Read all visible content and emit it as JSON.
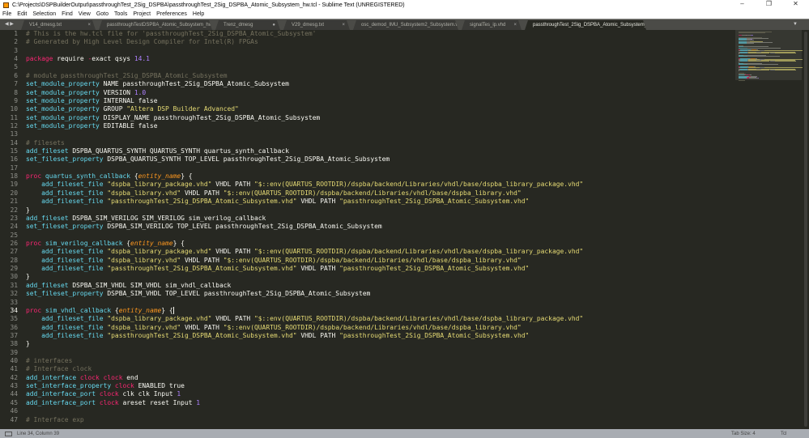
{
  "window": {
    "title": "C:\\Projects\\DSPBuilderOutput\\passthroughTest_2Sig_DSPBA\\passthroughTest_2Sig_DSPBA_Atomic_Subsystem_hw.tcl - Sublime Text (UNREGISTERED)",
    "minimize": "–",
    "maximize": "❐",
    "close": "✕"
  },
  "menu": [
    "File",
    "Edit",
    "Selection",
    "Find",
    "View",
    "Goto",
    "Tools",
    "Project",
    "Preferences",
    "Help"
  ],
  "tabs": [
    {
      "label": "V14_dmesg.txt",
      "mark": "×"
    },
    {
      "label": "passthroughTestDSPBA_Atomic_Subsystem_hw.tcl",
      "mark": "×"
    },
    {
      "label": "Trenz_dmesg",
      "mark": "●"
    },
    {
      "label": "V29_dmesg.txt",
      "mark": "×"
    },
    {
      "label": "osc_demod_IMU_Subsystem2_Subsystem.vhd",
      "mark": "×"
    },
    {
      "label": "signalTes_ip.vhd",
      "mark": "×"
    },
    {
      "label": "passthroughTest_2Sig_DSPBA_Atomic_Subsystem_hw.tcl",
      "mark": "×",
      "active": true
    }
  ],
  "tabnav": "◀ ▶",
  "tabmore": "▼",
  "cursor_line": 34,
  "lines": [
    [
      [
        "c",
        "# This is the hw.tcl file for 'passthroughTest_2Sig_DSPBA_Atomic_Subsystem'"
      ]
    ],
    [
      [
        "c",
        "# Generated by High Level Design Compiler for Intel(R) FPGAs"
      ]
    ],
    [],
    [
      [
        "k",
        "package"
      ],
      [
        "t",
        " require "
      ],
      [
        "k",
        "-"
      ],
      [
        "t",
        "exact qsys "
      ],
      [
        "n",
        "14.1"
      ]
    ],
    [],
    [
      [
        "c",
        "# module passthroughTest_2Sig_DSPBA_Atomic_Subsystem"
      ]
    ],
    [
      [
        "f",
        "set_module_property"
      ],
      [
        "t",
        " NAME passthroughTest_2Sig_DSPBA_Atomic_Subsystem"
      ]
    ],
    [
      [
        "f",
        "set_module_property"
      ],
      [
        "t",
        " VERSION "
      ],
      [
        "n",
        "1.0"
      ]
    ],
    [
      [
        "f",
        "set_module_property"
      ],
      [
        "t",
        " INTERNAL false"
      ]
    ],
    [
      [
        "f",
        "set_module_property"
      ],
      [
        "t",
        " GROUP "
      ],
      [
        "s",
        "\"Altera DSP Builder Advanced\""
      ]
    ],
    [
      [
        "f",
        "set_module_property"
      ],
      [
        "t",
        " DISPLAY_NAME passthroughTest_2Sig_DSPBA_Atomic_Subsystem"
      ]
    ],
    [
      [
        "f",
        "set_module_property"
      ],
      [
        "t",
        " EDITABLE false"
      ]
    ],
    [],
    [
      [
        "c",
        "# filesets"
      ]
    ],
    [
      [
        "f",
        "add_fileset"
      ],
      [
        "t",
        " DSPBA_QUARTUS_SYNTH QUARTUS_SYNTH quartus_synth_callback"
      ]
    ],
    [
      [
        "f",
        "set_fileset_property"
      ],
      [
        "t",
        " DSPBA_QUARTUS_SYNTH TOP_LEVEL passthroughTest_2Sig_DSPBA_Atomic_Subsystem"
      ]
    ],
    [],
    [
      [
        "k",
        "proc"
      ],
      [
        "f",
        " quartus_synth_callback"
      ],
      [
        "t",
        " {"
      ],
      [
        "p",
        "entity_name"
      ],
      [
        "t",
        "} {"
      ]
    ],
    [
      [
        "t",
        "    "
      ],
      [
        "f",
        "add_fileset_file"
      ],
      [
        "t",
        " "
      ],
      [
        "s",
        "\"dspba_library_package.vhd\""
      ],
      [
        "t",
        " VHDL PATH "
      ],
      [
        "s",
        "\"$::env(QUARTUS_ROOTDIR)/dspba/backend/Libraries/vhdl/base/dspba_library_package.vhd\""
      ]
    ],
    [
      [
        "t",
        "    "
      ],
      [
        "f",
        "add_fileset_file"
      ],
      [
        "t",
        " "
      ],
      [
        "s",
        "\"dspba_library.vhd\""
      ],
      [
        "t",
        " VHDL PATH "
      ],
      [
        "s",
        "\"$::env(QUARTUS_ROOTDIR)/dspba/backend/Libraries/vhdl/base/dspba_library.vhd\""
      ]
    ],
    [
      [
        "t",
        "    "
      ],
      [
        "f",
        "add_fileset_file"
      ],
      [
        "t",
        " "
      ],
      [
        "s",
        "\"passthroughTest_2Sig_DSPBA_Atomic_Subsystem.vhd\""
      ],
      [
        "t",
        " VHDL PATH "
      ],
      [
        "s",
        "\"passthroughTest_2Sig_DSPBA_Atomic_Subsystem.vhd\""
      ]
    ],
    [
      [
        "t",
        "}"
      ]
    ],
    [
      [
        "f",
        "add_fileset"
      ],
      [
        "t",
        " DSPBA_SIM_VERILOG SIM_VERILOG sim_verilog_callback"
      ]
    ],
    [
      [
        "f",
        "set_fileset_property"
      ],
      [
        "t",
        " DSPBA_SIM_VERILOG TOP_LEVEL passthroughTest_2Sig_DSPBA_Atomic_Subsystem"
      ]
    ],
    [],
    [
      [
        "k",
        "proc"
      ],
      [
        "f",
        " sim_verilog_callback"
      ],
      [
        "t",
        " {"
      ],
      [
        "p",
        "entity_name"
      ],
      [
        "t",
        "} {"
      ]
    ],
    [
      [
        "t",
        "    "
      ],
      [
        "f",
        "add_fileset_file"
      ],
      [
        "t",
        " "
      ],
      [
        "s",
        "\"dspba_library_package.vhd\""
      ],
      [
        "t",
        " VHDL PATH "
      ],
      [
        "s",
        "\"$::env(QUARTUS_ROOTDIR)/dspba/backend/Libraries/vhdl/base/dspba_library_package.vhd\""
      ]
    ],
    [
      [
        "t",
        "    "
      ],
      [
        "f",
        "add_fileset_file"
      ],
      [
        "t",
        " "
      ],
      [
        "s",
        "\"dspba_library.vhd\""
      ],
      [
        "t",
        " VHDL PATH "
      ],
      [
        "s",
        "\"$::env(QUARTUS_ROOTDIR)/dspba/backend/Libraries/vhdl/base/dspba_library.vhd\""
      ]
    ],
    [
      [
        "t",
        "    "
      ],
      [
        "f",
        "add_fileset_file"
      ],
      [
        "t",
        " "
      ],
      [
        "s",
        "\"passthroughTest_2Sig_DSPBA_Atomic_Subsystem.vhd\""
      ],
      [
        "t",
        " VHDL PATH "
      ],
      [
        "s",
        "\"passthroughTest_2Sig_DSPBA_Atomic_Subsystem.vhd\""
      ]
    ],
    [
      [
        "t",
        "}"
      ]
    ],
    [
      [
        "f",
        "add_fileset"
      ],
      [
        "t",
        " DSPBA_SIM_VHDL SIM_VHDL sim_vhdl_callback"
      ]
    ],
    [
      [
        "f",
        "set_fileset_property"
      ],
      [
        "t",
        " DSPBA_SIM_VHDL TOP_LEVEL passthroughTest_2Sig_DSPBA_Atomic_Subsystem"
      ]
    ],
    [],
    [
      [
        "k",
        "proc"
      ],
      [
        "f",
        " sim_vhdl_callback"
      ],
      [
        "t",
        " {"
      ],
      [
        "p",
        "entity_name"
      ],
      [
        "t",
        "} {"
      ]
    ],
    [
      [
        "t",
        "    "
      ],
      [
        "f",
        "add_fileset_file"
      ],
      [
        "t",
        " "
      ],
      [
        "s",
        "\"dspba_library_package.vhd\""
      ],
      [
        "t",
        " VHDL PATH "
      ],
      [
        "s",
        "\"$::env(QUARTUS_ROOTDIR)/dspba/backend/Libraries/vhdl/base/dspba_library_package.vhd\""
      ]
    ],
    [
      [
        "t",
        "    "
      ],
      [
        "f",
        "add_fileset_file"
      ],
      [
        "t",
        " "
      ],
      [
        "s",
        "\"dspba_library.vhd\""
      ],
      [
        "t",
        " VHDL PATH "
      ],
      [
        "s",
        "\"$::env(QUARTUS_ROOTDIR)/dspba/backend/Libraries/vhdl/base/dspba_library.vhd\""
      ]
    ],
    [
      [
        "t",
        "    "
      ],
      [
        "f",
        "add_fileset_file"
      ],
      [
        "t",
        " "
      ],
      [
        "s",
        "\"passthroughTest_2Sig_DSPBA_Atomic_Subsystem.vhd\""
      ],
      [
        "t",
        " VHDL PATH "
      ],
      [
        "s",
        "\"passthroughTest_2Sig_DSPBA_Atomic_Subsystem.vhd\""
      ]
    ],
    [
      [
        "t",
        "}"
      ]
    ],
    [],
    [
      [
        "c",
        "# interfaces"
      ]
    ],
    [
      [
        "c",
        "# Interface clock"
      ]
    ],
    [
      [
        "f",
        "add_interface"
      ],
      [
        "t",
        " "
      ],
      [
        "k",
        "clock"
      ],
      [
        "t",
        " "
      ],
      [
        "k",
        "clock"
      ],
      [
        "t",
        " end"
      ]
    ],
    [
      [
        "f",
        "set_interface_property"
      ],
      [
        "t",
        " "
      ],
      [
        "k",
        "clock"
      ],
      [
        "t",
        " ENABLED true"
      ]
    ],
    [
      [
        "f",
        "add_interface_port"
      ],
      [
        "t",
        " "
      ],
      [
        "k",
        "clock"
      ],
      [
        "t",
        " clk clk Input "
      ],
      [
        "n",
        "1"
      ]
    ],
    [
      [
        "f",
        "add_interface_port"
      ],
      [
        "t",
        " "
      ],
      [
        "k",
        "clock"
      ],
      [
        "t",
        " areset reset Input "
      ],
      [
        "n",
        "1"
      ]
    ],
    [],
    [
      [
        "c",
        "# Interface exp"
      ]
    ]
  ],
  "status": {
    "position": "Line 34, Column 39",
    "tab_size": "Tab Size: 4",
    "syntax": "Tcl"
  }
}
